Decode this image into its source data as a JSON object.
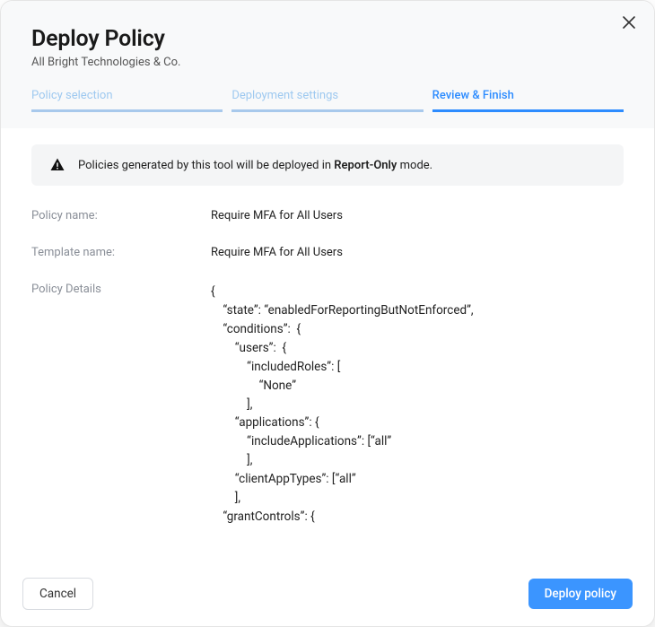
{
  "header": {
    "title": "Deploy Policy",
    "subtitle": "All Bright Technologies & Co."
  },
  "tabs": [
    {
      "label": "Policy selection",
      "active": false
    },
    {
      "label": "Deployment settings",
      "active": false
    },
    {
      "label": "Review & Finish",
      "active": true
    }
  ],
  "alert": {
    "prefix": "Policies generated by this tool will be deployed in ",
    "bold": "Report-Only",
    "suffix": " mode."
  },
  "details": {
    "policy_name_label": "Policy name:",
    "policy_name_value": "Require MFA for All Users",
    "template_name_label": "Template name:",
    "template_name_value": "Require MFA for All Users",
    "policy_details_label": "Policy Details",
    "json_text": "{\n    “state”: “enabledForReportingButNotEnforced”,\n    “conditions”:  {\n        “users”:  {\n            “includedRoles”: [\n                “None”\n            ],\n        “applications”: {\n            “includeApplications”: [“all”\n            ],\n        “clientAppTypes”: [“all”\n        ],\n    “grantControls”: {"
  },
  "footer": {
    "cancel": "Cancel",
    "deploy": "Deploy policy"
  }
}
